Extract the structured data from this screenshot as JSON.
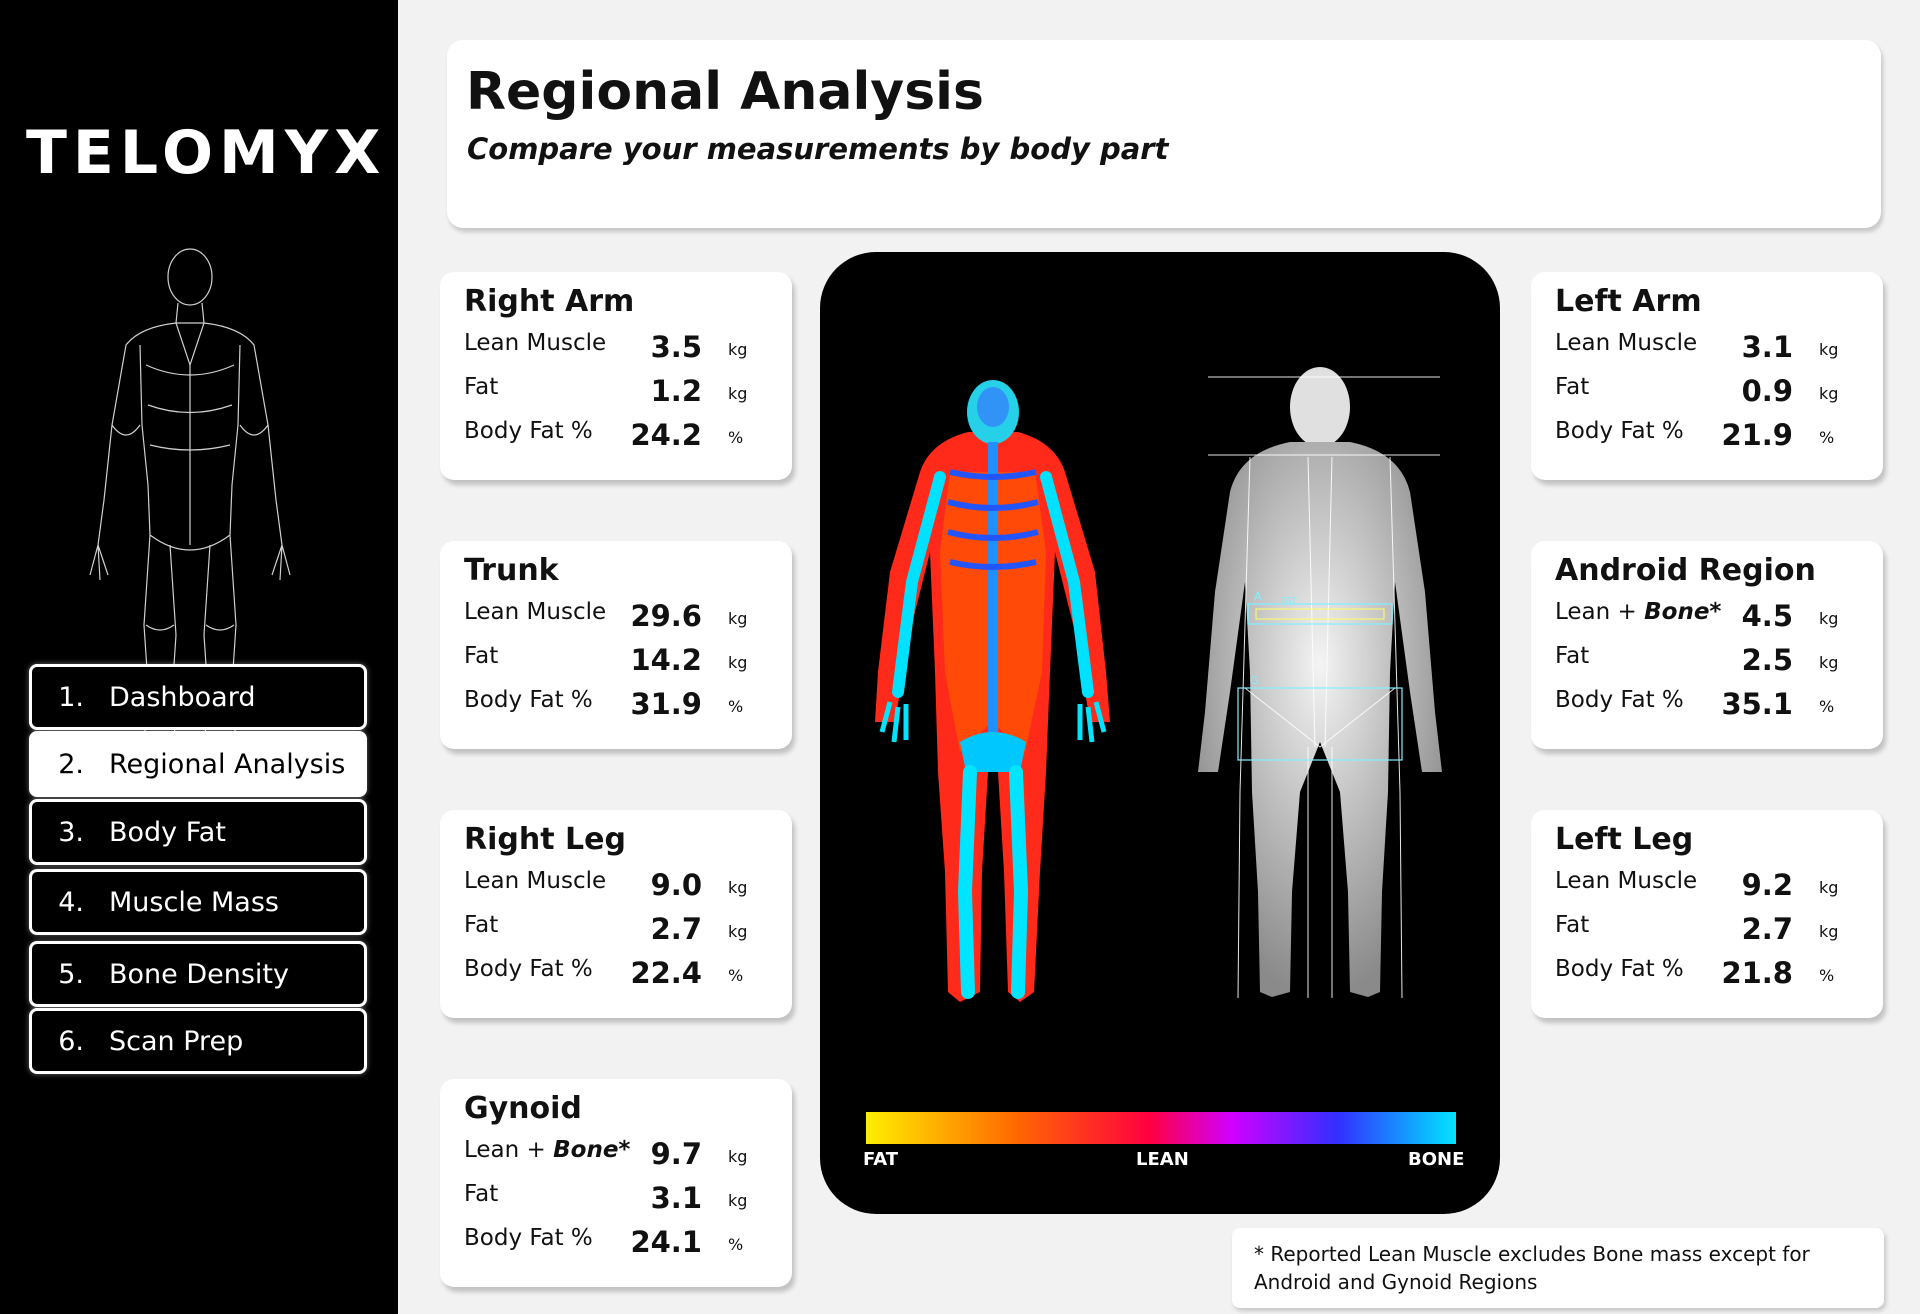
{
  "brand": {
    "logo": "TELOMYX"
  },
  "nav": [
    {
      "num": "1.",
      "label": "Dashboard",
      "active": false
    },
    {
      "num": "2.",
      "label": "Regional Analysis",
      "active": true
    },
    {
      "num": "3.",
      "label": "Body Fat",
      "active": false
    },
    {
      "num": "4.",
      "label": "Muscle Mass",
      "active": false
    },
    {
      "num": "5.",
      "label": "Bone Density",
      "active": false
    },
    {
      "num": "6.",
      "label": "Scan Prep",
      "active": false
    }
  ],
  "header": {
    "title": "Regional Analysis",
    "subtitle": "Compare your measurements by body part"
  },
  "regions": {
    "right_arm": {
      "title": "Right Arm",
      "rows": [
        {
          "label": "Lean Muscle",
          "value": "3.5",
          "unit": "kg"
        },
        {
          "label": "Fat",
          "value": "1.2",
          "unit": "kg"
        },
        {
          "label": "Body Fat %",
          "value": "24.2",
          "unit": "%"
        }
      ]
    },
    "trunk": {
      "title": "Trunk",
      "rows": [
        {
          "label": "Lean Muscle",
          "value": "29.6",
          "unit": "kg"
        },
        {
          "label": "Fat",
          "value": "14.2",
          "unit": "kg"
        },
        {
          "label": "Body Fat %",
          "value": "31.9",
          "unit": "%"
        }
      ]
    },
    "right_leg": {
      "title": "Right Leg",
      "rows": [
        {
          "label": "Lean Muscle",
          "value": "9.0",
          "unit": "kg"
        },
        {
          "label": "Fat",
          "value": "2.7",
          "unit": "kg"
        },
        {
          "label": "Body Fat %",
          "value": "22.4",
          "unit": "%"
        }
      ]
    },
    "gynoid": {
      "title": "Gynoid",
      "rows": [
        {
          "label_prefix": "Lean + ",
          "label_em": "Bone*",
          "value": "9.7",
          "unit": "kg"
        },
        {
          "label": "Fat",
          "value": "3.1",
          "unit": "kg"
        },
        {
          "label": "Body Fat %",
          "value": "24.1",
          "unit": "%"
        }
      ]
    },
    "left_arm": {
      "title": "Left Arm",
      "rows": [
        {
          "label": "Lean Muscle",
          "value": "3.1",
          "unit": "kg"
        },
        {
          "label": "Fat",
          "value": "0.9",
          "unit": "kg"
        },
        {
          "label": "Body Fat %",
          "value": "21.9",
          "unit": "%"
        }
      ]
    },
    "android": {
      "title": "Android Region",
      "rows": [
        {
          "label_prefix": "Lean + ",
          "label_em": "Bone*",
          "value": "4.5",
          "unit": "kg"
        },
        {
          "label": "Fat",
          "value": "2.5",
          "unit": "kg"
        },
        {
          "label": "Body Fat %",
          "value": "35.1",
          "unit": "%"
        }
      ]
    },
    "left_leg": {
      "title": "Left Leg",
      "rows": [
        {
          "label": "Lean Muscle",
          "value": "9.2",
          "unit": "kg"
        },
        {
          "label": "Fat",
          "value": "2.7",
          "unit": "kg"
        },
        {
          "label": "Body Fat %",
          "value": "21.8",
          "unit": "%"
        }
      ]
    }
  },
  "scan": {
    "colorbar_labels": {
      "fat": "FAT",
      "lean": "LEAN",
      "bone": "BONE"
    },
    "region_markers": {
      "android": "A",
      "gynoid": "G",
      "fat_tag": "FAT"
    },
    "colors": {
      "fat": "#ffee00",
      "mid1": "#ff6a00",
      "mid2": "#ff0040",
      "mid3": "#d000ff",
      "mid4": "#3030ff",
      "bone": "#00e5ff"
    }
  },
  "footnote": {
    "line1": "* Reported Lean Muscle excludes Bone mass except for",
    "line2": "Android and Gynoid Regions"
  }
}
